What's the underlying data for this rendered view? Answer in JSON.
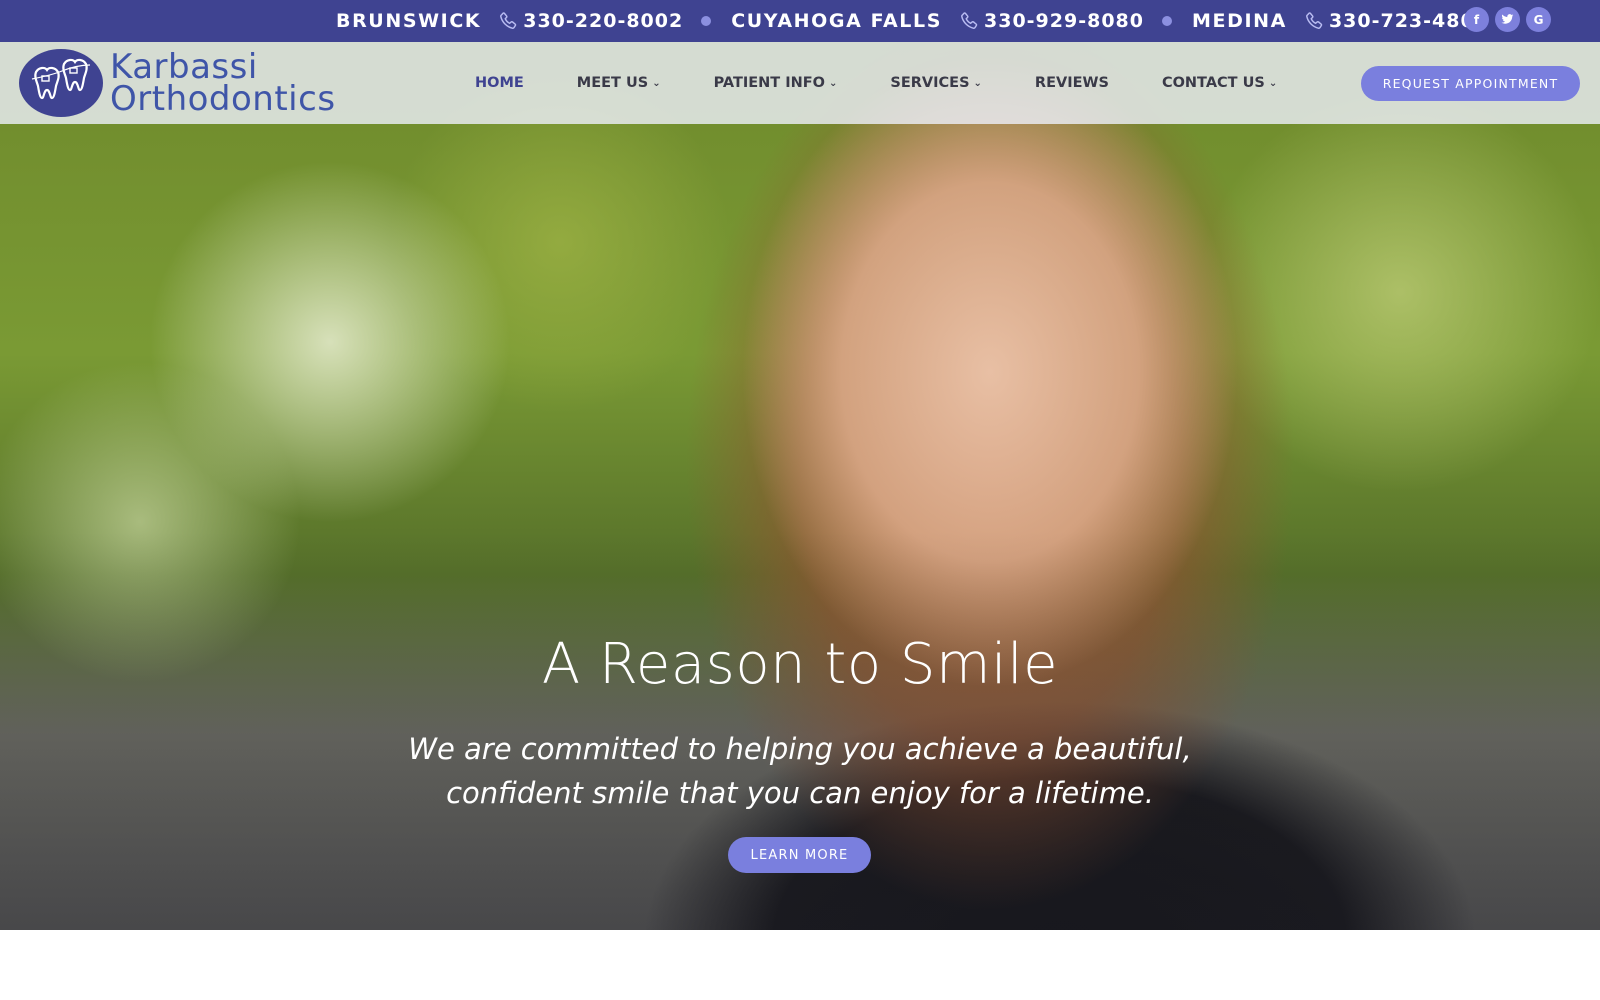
{
  "topbar": {
    "locations": [
      {
        "name": "BRUNSWICK",
        "phone": "330-220-8002"
      },
      {
        "name": "CUYAHOGA FALLS",
        "phone": "330-929-8080"
      },
      {
        "name": "MEDINA",
        "phone": "330-723-4800"
      }
    ],
    "socials": [
      {
        "icon": "facebook-icon",
        "glyph": "f"
      },
      {
        "icon": "twitter-icon",
        "glyph": "t"
      },
      {
        "icon": "google-icon",
        "glyph": "G"
      }
    ],
    "colors": {
      "background": "#3f4391",
      "dot": "#8c90e0",
      "social": "#7d80dc"
    }
  },
  "header": {
    "logo": {
      "line1": "Karbassi",
      "line2": "Orthodontics",
      "color": "#3f55a8"
    },
    "nav": [
      {
        "label": "HOME",
        "dropdown": false,
        "active": true
      },
      {
        "label": "MEET US",
        "dropdown": true,
        "active": false
      },
      {
        "label": "PATIENT INFO",
        "dropdown": true,
        "active": false
      },
      {
        "label": "SERVICES",
        "dropdown": true,
        "active": false
      },
      {
        "label": "REVIEWS",
        "dropdown": false,
        "active": false
      },
      {
        "label": "CONTACT US",
        "dropdown": true,
        "active": false
      }
    ],
    "request_button": "REQUEST APPOINTMENT"
  },
  "hero": {
    "title": "A Reason to Smile",
    "subtitle": "We are committed to helping you achieve a beautiful, confident smile that you can enjoy for a lifetime.",
    "button": "LEARN MORE",
    "accent": "#7a7fde"
  }
}
